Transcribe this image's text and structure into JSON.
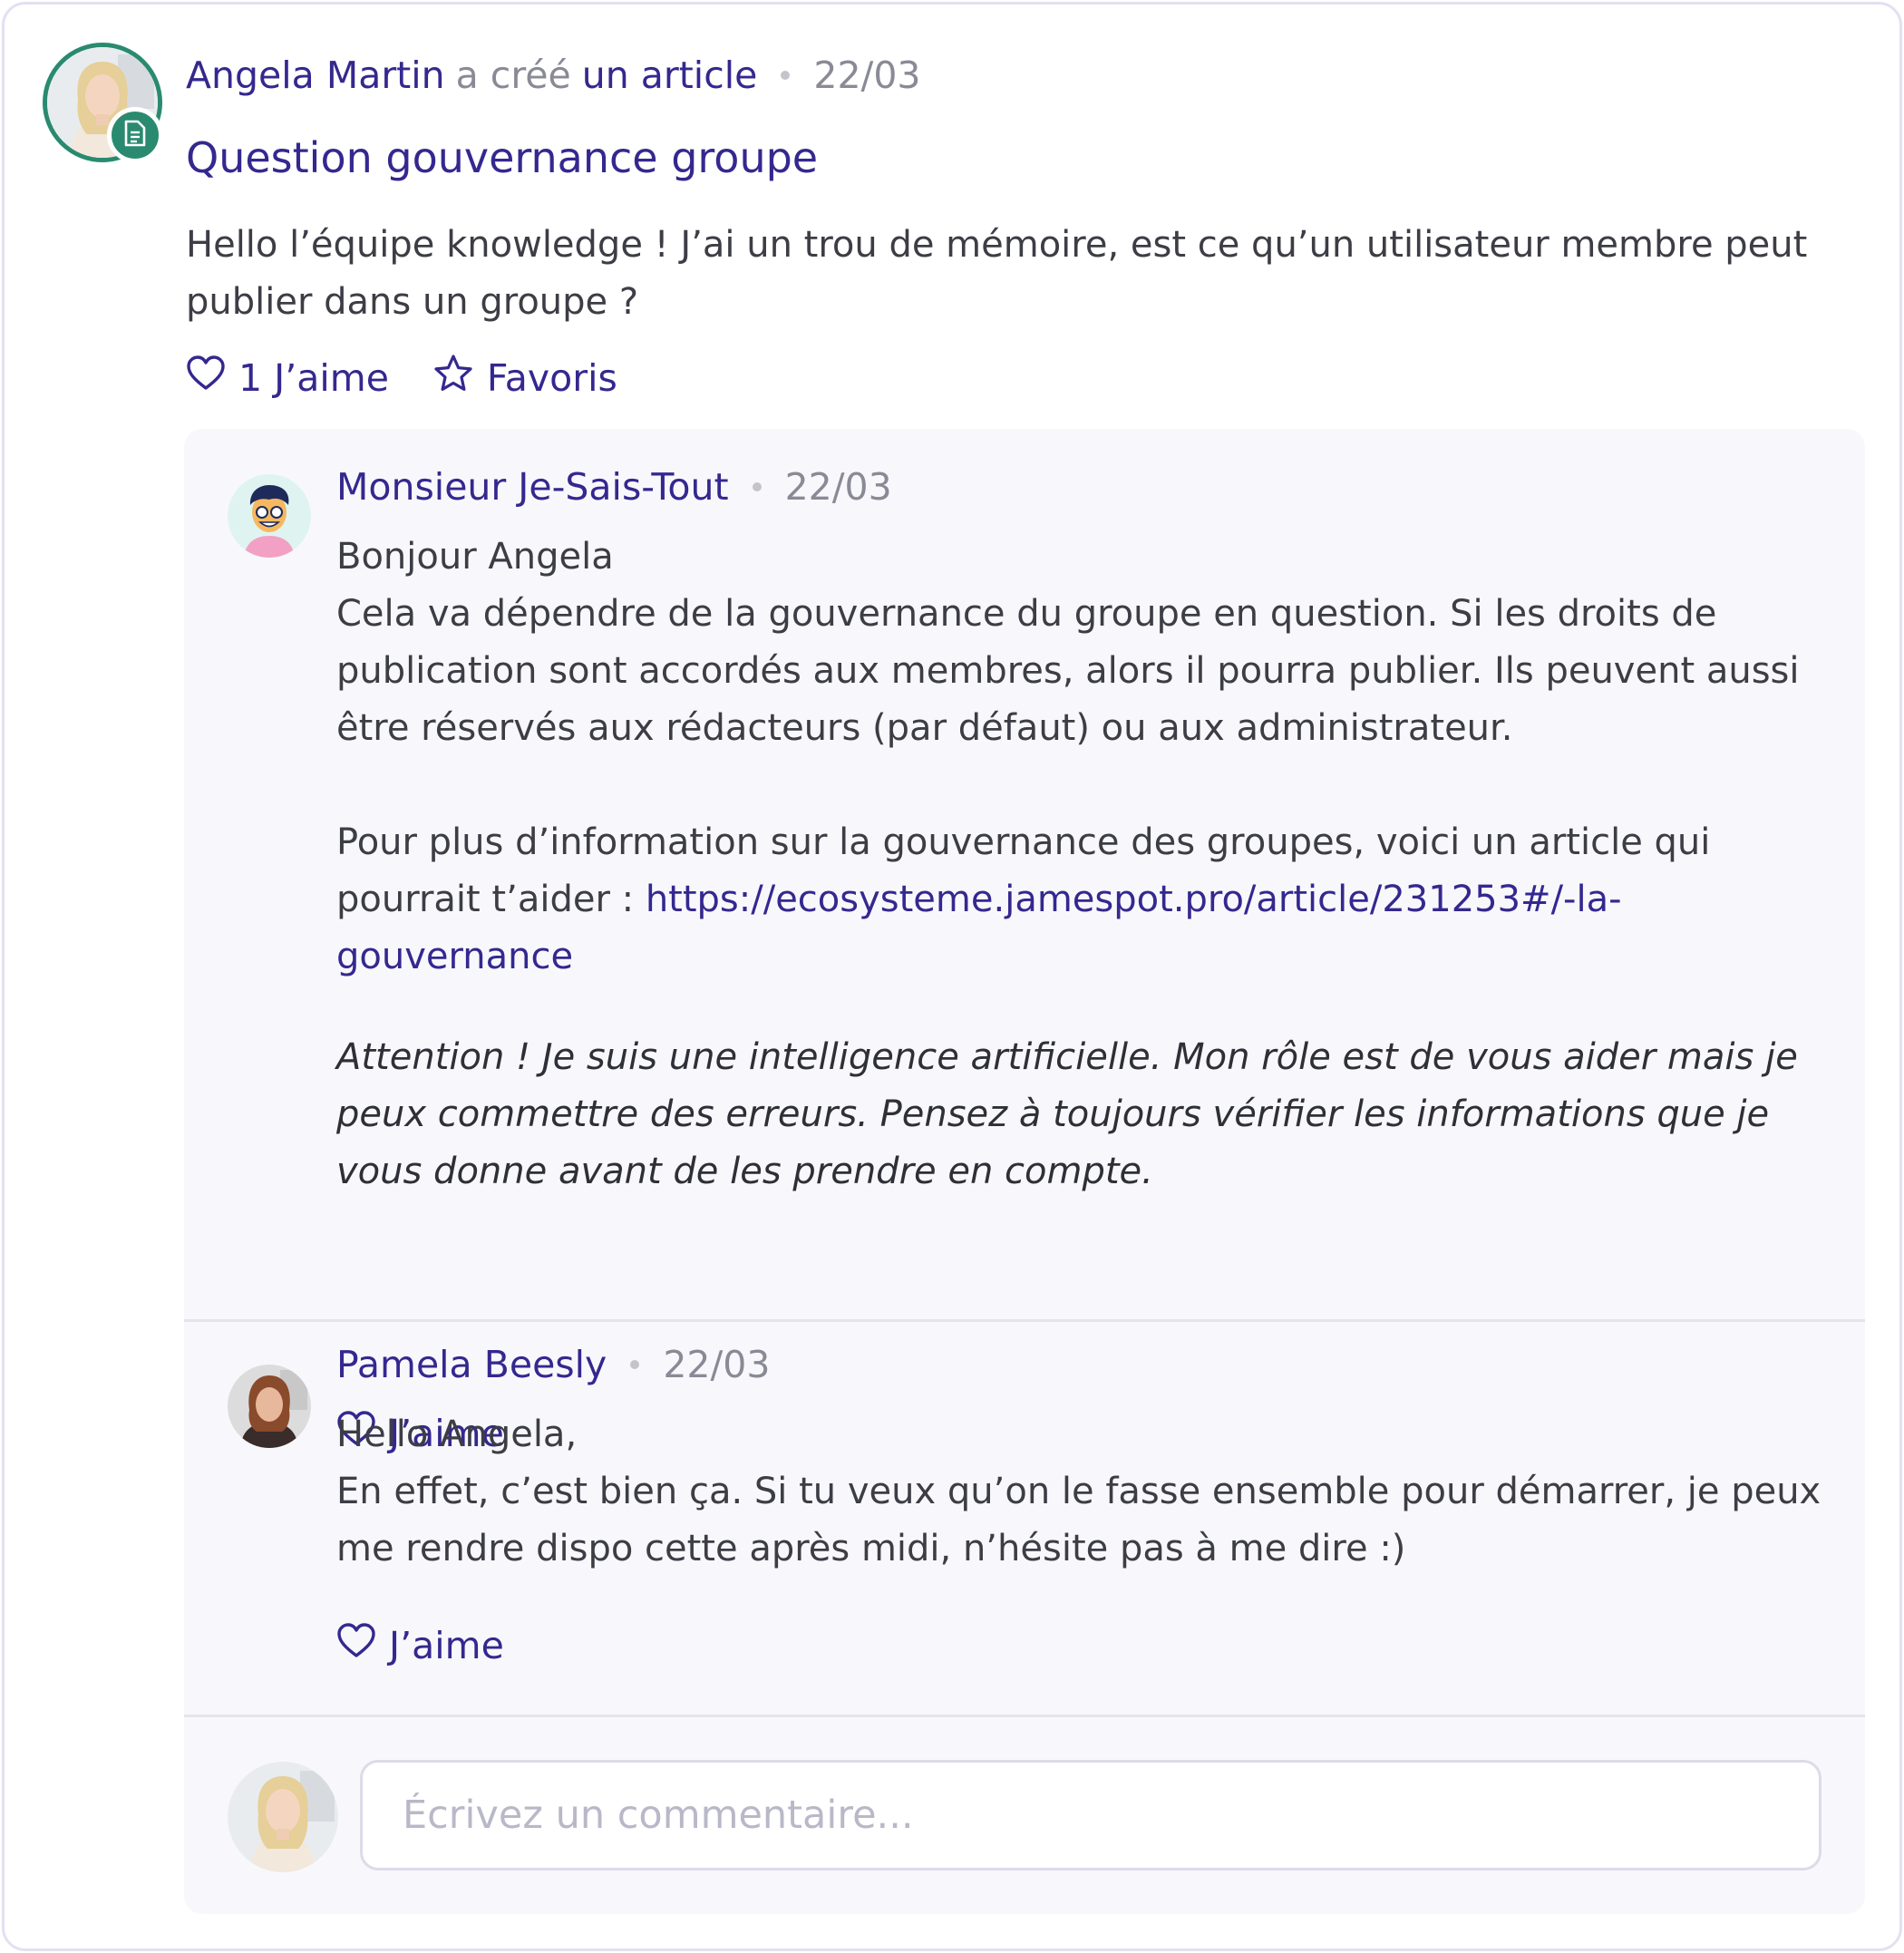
{
  "post": {
    "author": "Angela Martin",
    "action": "a créé",
    "object": "un article",
    "date": "22/03",
    "title": "Question gouvernance groupe",
    "body": "Hello l’équipe knowledge ! J’ai un trou de mémoire, est ce qu’un utilisateur membre peut publier dans un groupe ?",
    "like_label": "1 J’aime",
    "favorite_label": "Favoris"
  },
  "comments": [
    {
      "author": "Monsieur Je-Sais-Tout",
      "date": "22/03",
      "greeting": "Bonjour Angela",
      "paragraph1": "Cela va dépendre de la gouvernance du groupe en question. Si les droits de publication sont accordés aux membres, alors il pourra publier. Ils peuvent aussi être réservés aux rédacteurs (par défaut) ou aux administrateur.",
      "paragraph2": "Pour plus d’information sur la gouvernance des groupes, voici un article qui pourrait t’aider : ",
      "link": "https://ecosysteme.jamespot.pro/article/231253#/-la-gouvernance",
      "note": "Attention ! Je suis une intelligence artificielle. Mon rôle est de vous aider mais je peux commettre des erreurs. Pensez à toujours vérifier les informations que je vous donne avant de les prendre en compte.",
      "like_label": "J’aime"
    },
    {
      "author": "Pamela Beesly",
      "date": "22/03",
      "greeting": "Hello Angela,",
      "paragraph1": "En effet, c’est bien ça. Si tu veux qu’on le fasse ensemble pour démarrer, je peux me rendre dispo cette après midi, n’hésite pas à me dire :)",
      "like_label": "J’aime"
    }
  ],
  "composer": {
    "placeholder": "Écrivez un commentaire..."
  },
  "colors": {
    "accent": "#34288f",
    "badge": "#2a8a70",
    "panel": "#f8f8fc"
  },
  "icons": {
    "like": "heart-icon",
    "favorite": "star-icon",
    "article": "document-icon"
  }
}
